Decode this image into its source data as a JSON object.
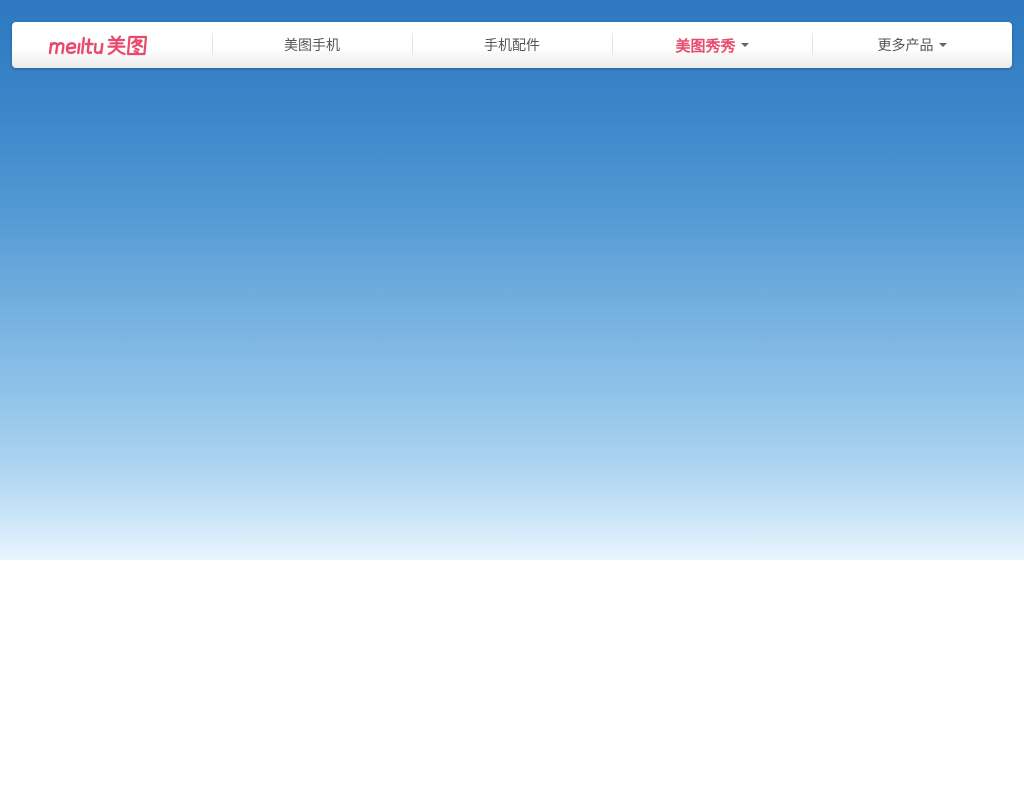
{
  "brand": {
    "logo_text": "meitu美图",
    "color": "#e84a6d"
  },
  "nav": {
    "items": [
      {
        "label": "美图手机",
        "has_dropdown": false,
        "active": false
      },
      {
        "label": "手机配件",
        "has_dropdown": false,
        "active": false
      },
      {
        "label": "美图秀秀",
        "has_dropdown": true,
        "active": true
      },
      {
        "label": "更多产品",
        "has_dropdown": true,
        "active": false
      }
    ],
    "active_color": "#e84a6d",
    "text_color": "#555555"
  },
  "hero": {
    "gradient_top": "#2e78c0",
    "gradient_bottom": "#eaf5fd"
  },
  "icons": {
    "dropdown": "caret-down-icon"
  }
}
